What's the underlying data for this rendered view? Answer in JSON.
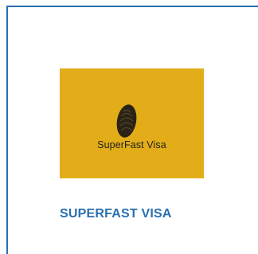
{
  "card": {
    "title": "SUPERFAST VISA",
    "accent_color": "#2a6fb0",
    "logo": {
      "text": "SuperFast Visa",
      "background_color": "#e2ad18",
      "icon": "fingerprint-icon"
    }
  }
}
